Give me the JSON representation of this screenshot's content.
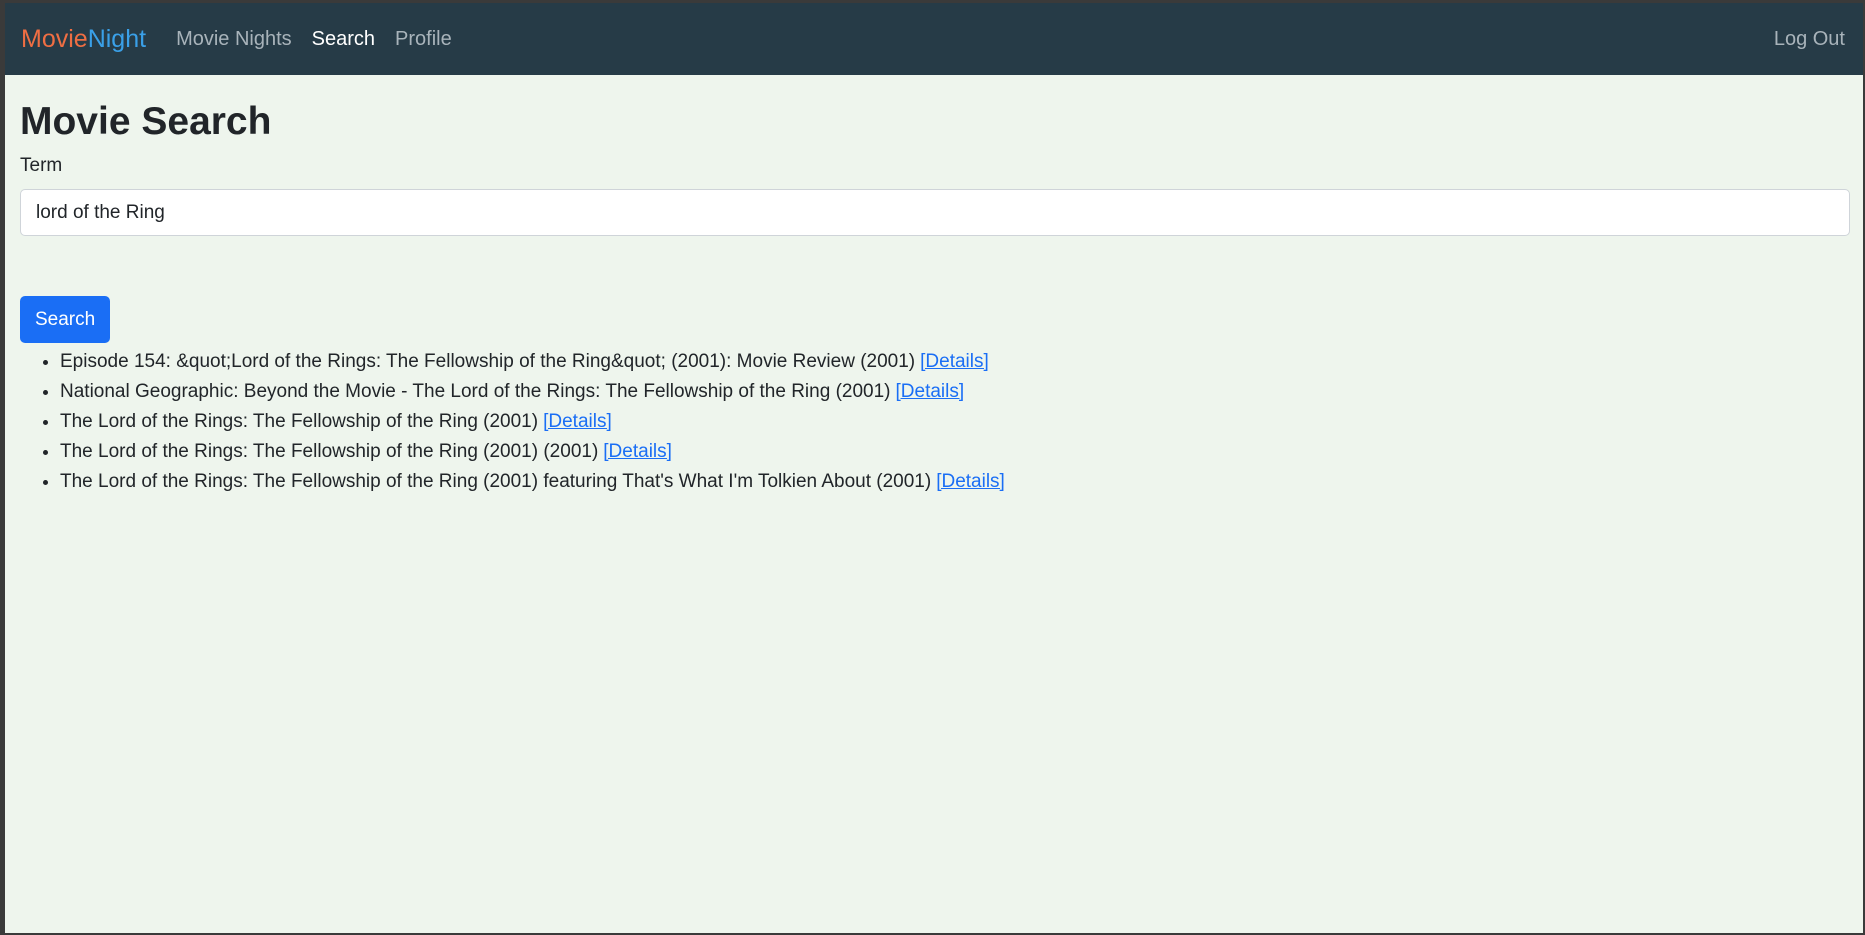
{
  "nav": {
    "brand_part1": "Movie",
    "brand_part2": "Night",
    "links": [
      {
        "label": "Movie Nights"
      },
      {
        "label": "Search"
      },
      {
        "label": "Profile"
      }
    ],
    "logout_label": "Log Out"
  },
  "page": {
    "title": "Movie Search",
    "term_label": "Term",
    "term_value": "lord of the Ring",
    "search_button": "Search"
  },
  "results": [
    {
      "text": "Episode 154: &quot;Lord of the Rings: The Fellowship of the Ring&quot; (2001): Movie Review (2001)",
      "link": "[Details]"
    },
    {
      "text": "National Geographic: Beyond the Movie - The Lord of the Rings: The Fellowship of the Ring (2001)",
      "link": "[Details]"
    },
    {
      "text": "The Lord of the Rings: The Fellowship of the Ring (2001)",
      "link": "[Details]"
    },
    {
      "text": "The Lord of the Rings: The Fellowship of the Ring (2001) (2001)",
      "link": "[Details]"
    },
    {
      "text": "The Lord of the Rings: The Fellowship of the Ring (2001) featuring That's What I'm Tolkien About (2001)",
      "link": "[Details]"
    }
  ]
}
